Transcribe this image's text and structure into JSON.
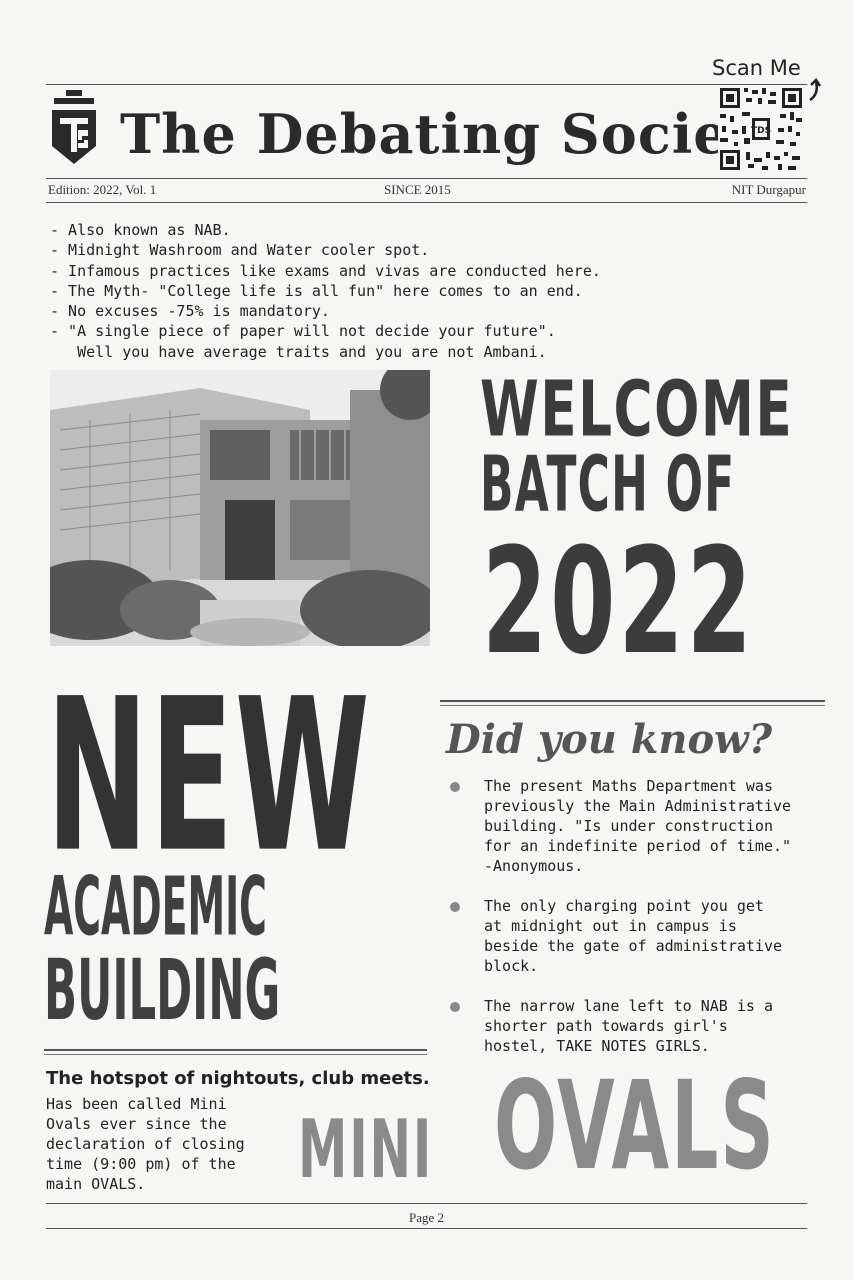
{
  "masthead": {
    "title": "The Debating Society",
    "logo_letters": "TDS",
    "scan_label": "Scan Me",
    "edition": "Edition: 2022, Vol. 1",
    "since": "SINCE 2015",
    "institute": "NIT Durgapur"
  },
  "intro_bullets": [
    "- Also known as NAB.",
    "- Midnight Washroom and Water cooler spot.",
    "- Infamous practices like exams and vivas are conducted here.",
    "- The Myth- \"College life is all fun\" here comes to an end.",
    "- No excuses -75% is mandatory.",
    "- \"A single piece of paper will not decide your future\".",
    "   Well you have average traits and you are not Ambani."
  ],
  "welcome": {
    "line1": "WELCOME",
    "line2": "BATCH OF",
    "year": "2022"
  },
  "feature": {
    "line1": "NEW",
    "line2": "ACADEMIC",
    "line3": "BUILDING"
  },
  "did_you_know": {
    "title": "Did you know?",
    "facts": [
      "The present Maths Department was\npreviously the Main Administrative\nbuilding. \"Is under construction\nfor an indefinite period of time.\"\n-Anonymous.",
      "The only charging point you get\nat midnight out in campus is\nbeside the gate of administrative\nblock.",
      "The narrow lane left to NAB is a\nshorter path towards girl's\nhostel, TAKE NOTES GIRLS."
    ]
  },
  "hotspot": {
    "title": "The hotspot of nightouts, club meets.",
    "body": [
      "Has been called Mini",
      "Ovals ever since the",
      "declaration of closing",
      "time (9:00 pm) of the",
      "main OVALS."
    ]
  },
  "mini_ovals": {
    "word1": "MINI",
    "word2": "OVALS"
  },
  "footer": {
    "page": "Page 2"
  },
  "colors": {
    "ink": "#222222",
    "poster_ink": "#3c3c3c",
    "faded": "#888888"
  }
}
